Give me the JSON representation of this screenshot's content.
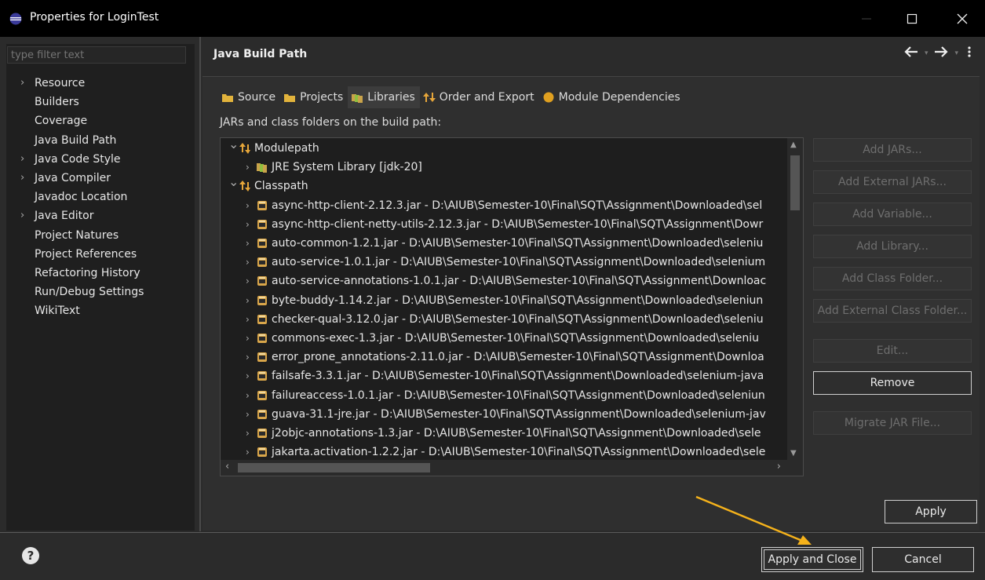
{
  "window": {
    "title": "Properties for LoginTest",
    "controls": {
      "minimize": "minimize",
      "maximize": "maximize",
      "close": "close"
    }
  },
  "left": {
    "filter_placeholder": "type filter text",
    "items": [
      {
        "label": "Resource",
        "expandable": true
      },
      {
        "label": "Builders",
        "expandable": false
      },
      {
        "label": "Coverage",
        "expandable": false
      },
      {
        "label": "Java Build Path",
        "expandable": false
      },
      {
        "label": "Java Code Style",
        "expandable": true
      },
      {
        "label": "Java Compiler",
        "expandable": true
      },
      {
        "label": "Javadoc Location",
        "expandable": false
      },
      {
        "label": "Java Editor",
        "expandable": true
      },
      {
        "label": "Project Natures",
        "expandable": false
      },
      {
        "label": "Project References",
        "expandable": false
      },
      {
        "label": "Refactoring History",
        "expandable": false
      },
      {
        "label": "Run/Debug Settings",
        "expandable": false
      },
      {
        "label": "WikiText",
        "expandable": false
      }
    ]
  },
  "header": {
    "title": "Java Build Path"
  },
  "tabs": [
    {
      "label": "Source",
      "icon": "source-folder-icon"
    },
    {
      "label": "Projects",
      "icon": "projects-icon"
    },
    {
      "label": "Libraries",
      "icon": "libraries-icon",
      "active": true
    },
    {
      "label": "Order and Export",
      "icon": "order-export-icon"
    },
    {
      "label": "Module Dependencies",
      "icon": "module-icon"
    }
  ],
  "libraries": {
    "section_label": "JARs and class folders on the build path:",
    "rows": [
      {
        "label": "Modulepath",
        "level": 0,
        "expanded": true,
        "kind": "group"
      },
      {
        "label": "JRE System Library [jdk-20]",
        "level": 1,
        "expanded": false,
        "kind": "library"
      },
      {
        "label": "Classpath",
        "level": 0,
        "expanded": true,
        "kind": "group"
      },
      {
        "label": "async-http-client-2.12.3.jar - D:\\AIUB\\Semester-10\\Final\\SQT\\Assignment\\Downloaded\\sel",
        "level": 1,
        "kind": "jar"
      },
      {
        "label": "async-http-client-netty-utils-2.12.3.jar - D:\\AIUB\\Semester-10\\Final\\SQT\\Assignment\\Dowr",
        "level": 1,
        "kind": "jar"
      },
      {
        "label": "auto-common-1.2.1.jar - D:\\AIUB\\Semester-10\\Final\\SQT\\Assignment\\Downloaded\\seleniu",
        "level": 1,
        "kind": "jar"
      },
      {
        "label": "auto-service-1.0.1.jar - D:\\AIUB\\Semester-10\\Final\\SQT\\Assignment\\Downloaded\\selenium",
        "level": 1,
        "kind": "jar"
      },
      {
        "label": "auto-service-annotations-1.0.1.jar - D:\\AIUB\\Semester-10\\Final\\SQT\\Assignment\\Downloac",
        "level": 1,
        "kind": "jar"
      },
      {
        "label": "byte-buddy-1.14.2.jar - D:\\AIUB\\Semester-10\\Final\\SQT\\Assignment\\Downloaded\\seleniun",
        "level": 1,
        "kind": "jar"
      },
      {
        "label": "checker-qual-3.12.0.jar - D:\\AIUB\\Semester-10\\Final\\SQT\\Assignment\\Downloaded\\seleniu",
        "level": 1,
        "kind": "jar"
      },
      {
        "label": "commons-exec-1.3.jar - D:\\AIUB\\Semester-10\\Final\\SQT\\Assignment\\Downloaded\\seleniu",
        "level": 1,
        "kind": "jar"
      },
      {
        "label": "error_prone_annotations-2.11.0.jar - D:\\AIUB\\Semester-10\\Final\\SQT\\Assignment\\Downloa",
        "level": 1,
        "kind": "jar"
      },
      {
        "label": "failsafe-3.3.1.jar - D:\\AIUB\\Semester-10\\Final\\SQT\\Assignment\\Downloaded\\selenium-java",
        "level": 1,
        "kind": "jar"
      },
      {
        "label": "failureaccess-1.0.1.jar - D:\\AIUB\\Semester-10\\Final\\SQT\\Assignment\\Downloaded\\seleniun",
        "level": 1,
        "kind": "jar"
      },
      {
        "label": "guava-31.1-jre.jar - D:\\AIUB\\Semester-10\\Final\\SQT\\Assignment\\Downloaded\\selenium-jav",
        "level": 1,
        "kind": "jar"
      },
      {
        "label": "j2objc-annotations-1.3.jar - D:\\AIUB\\Semester-10\\Final\\SQT\\Assignment\\Downloaded\\sele",
        "level": 1,
        "kind": "jar"
      },
      {
        "label": "jakarta.activation-1.2.2.jar - D:\\AIUB\\Semester-10\\Final\\SQT\\Assignment\\Downloaded\\sele",
        "level": 1,
        "kind": "jar"
      }
    ]
  },
  "side_buttons": [
    {
      "label": "Add JARs...",
      "enabled": false
    },
    {
      "label": "Add External JARs...",
      "enabled": false
    },
    {
      "label": "Add Variable...",
      "enabled": false
    },
    {
      "label": "Add Library...",
      "enabled": false
    },
    {
      "label": "Add Class Folder...",
      "enabled": false
    },
    {
      "label": "Add External Class Folder...",
      "enabled": false
    },
    {
      "label": "Edit...",
      "enabled": false
    },
    {
      "label": "Remove",
      "enabled": true
    },
    {
      "label": "Migrate JAR File...",
      "enabled": false
    }
  ],
  "apply_label": "Apply",
  "footer": {
    "apply_close_label": "Apply and Close",
    "cancel_label": "Cancel"
  },
  "colors": {
    "accent_arrow": "#f5b21b",
    "jar_icon": "#d9a64a",
    "module_icon": "#e8b84a"
  }
}
